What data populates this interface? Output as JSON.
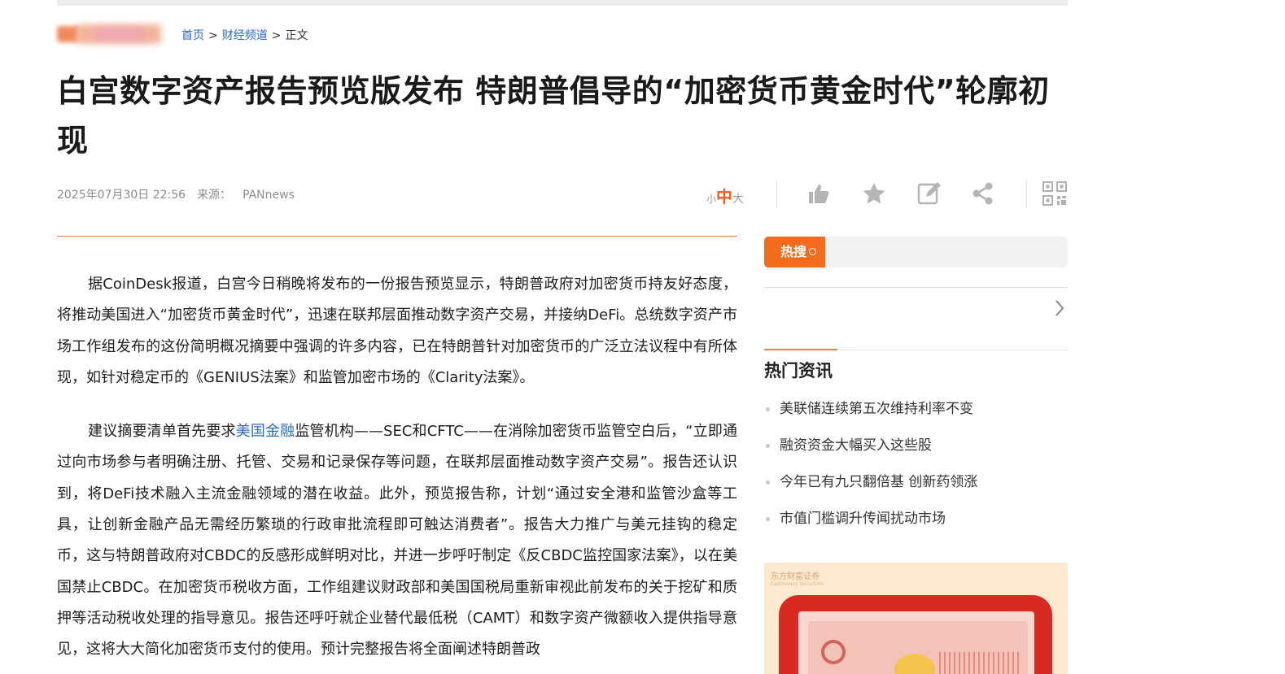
{
  "breadcrumb": {
    "home": "首页",
    "sep1": ">",
    "channel": "财经频道",
    "sep2": ">",
    "current": "正文"
  },
  "article": {
    "title": "白宫数字资产报告预览版发布 特朗普倡导的“加密货币黄金时代”轮廓初现",
    "date": "2025年07月30日 22:56",
    "source_label": "来源：",
    "source": "PANnews",
    "p1": "据CoinDesk报道，白宫今日稍晚将发布的一份报告预览显示，特朗普政府对加密货币持友好态度，将推动美国进入“加密货币黄金时代”，迅速在联邦层面推动数字资产交易，并接纳DeFi。总统数字资产市场工作组发布的这份简明概况摘要中强调的许多内容，已在特朗普针对加密货币的广泛立法议程中有所体现，如针对稳定币的《GENIUS法案》和监管加密市场的《Clarity法案》。",
    "p2_before_link": "建议摘要清单首先要求",
    "p2_link": "美国金融",
    "p2_after_link": "监管机构——SEC和CFTC——在消除加密货币监管空白后，“立即通过向市场参与者明确注册、托管、交易和记录保存等问题，在联邦层面推动数字资产交易”。报告还认识到，将DeFi技术融入主流金融领域的潜在收益。此外，预览报告称，计划“通过安全港和监管沙盒等工具，让创新金融产品无需经历繁琐的行政审批流程即可触达消费者”。报告大力推广与美元挂钩的稳定币，这与特朗普政府对CBDC的反感形成鲜明对比，并进一步呼吁制定《反CBDC监控国家法案》，以在美国禁止CBDC。在加密货币税收方面，工作组建议财政部和美国国税局重新审视此前发布的关于挖矿和质押等活动税收处理的指导意见。报告还呼吁就企业替代最低税（CAMT）和数字资产微额收入提供指导意见，这将大大简化加密货币支付的使用。预计完整报告将全面阐述特朗普政"
  },
  "fontsize": {
    "small": "小",
    "medium": "中",
    "large": "大"
  },
  "toolbar": {
    "like_icon": "thumbs-up-icon",
    "favorite_icon": "star-icon",
    "comment_icon": "edit-icon",
    "share_icon": "share-icon",
    "qr_icon": "qr-code-icon"
  },
  "sidebar": {
    "hot_search_label": "热搜",
    "hot_news_title": "热门资讯",
    "hot_news": [
      "美联储连续第五次维持利率不变",
      "融资资金大幅买入这些股",
      "今年已有九只翻倍基 创新药领涨",
      "市值门槛调升传闻扰动市场"
    ],
    "ad_brand": "东方财富证券",
    "ad_brand_en": "Eastmoney Securities"
  },
  "colors": {
    "accent": "#f36b1c",
    "link": "#2b6cc4",
    "rule": "#f0823c"
  }
}
